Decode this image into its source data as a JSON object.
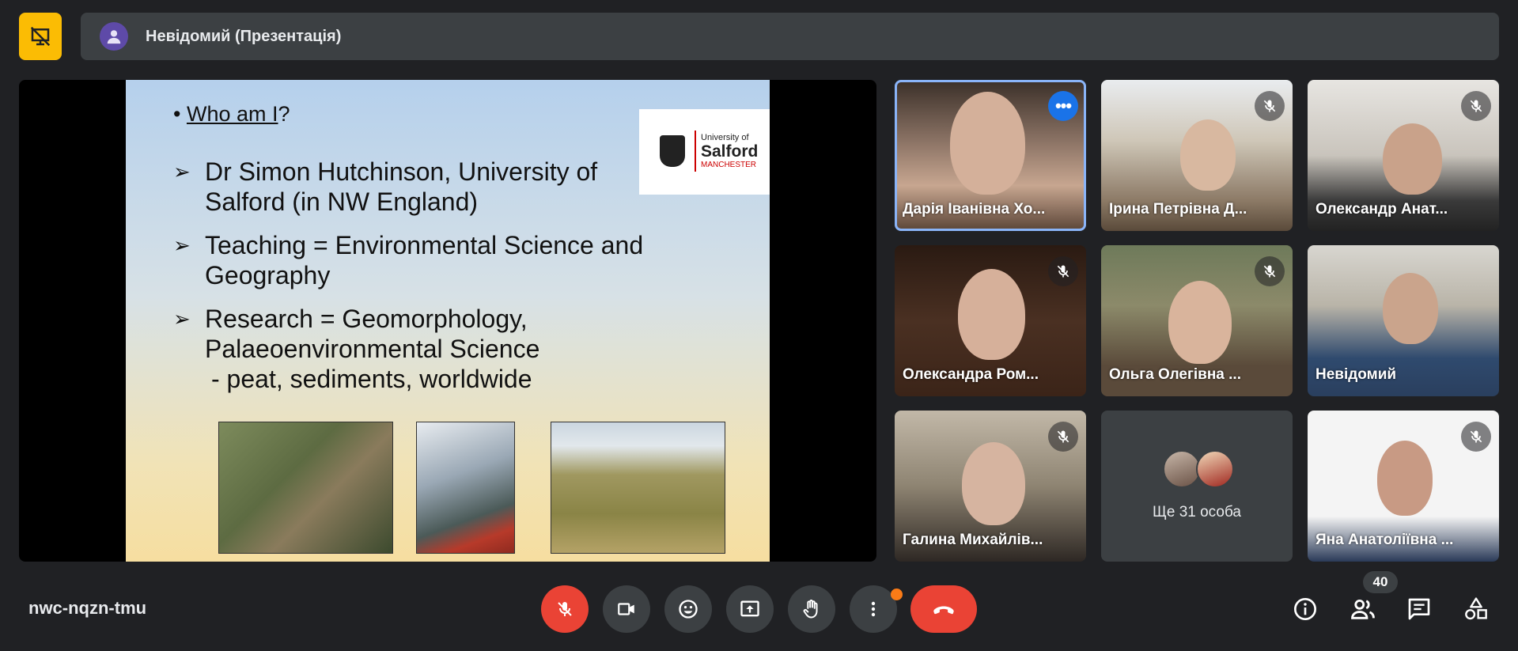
{
  "topbar": {
    "presenter_title": "Невідомий (Презентація)"
  },
  "slide": {
    "question_prefix": "• ",
    "question": "Who am I",
    "question_suffix": "?",
    "points": [
      {
        "arrow": "➢",
        "text": "Dr Simon Hutchinson, University of Salford (in NW England)"
      },
      {
        "arrow": "➢",
        "text": "Teaching = Environmental Science and Geography"
      },
      {
        "arrow": "➢",
        "text": "Research = Geomorphology, Palaeoenvironmental Science"
      }
    ],
    "sub_point": "- peat, sediments, worldwide",
    "logo": {
      "line1": "University of",
      "line2": "Salford",
      "line3": "MANCHESTER"
    }
  },
  "participants": [
    {
      "name": "Дарія Іванівна Хо...",
      "state": "active",
      "icon": "more-options-icon"
    },
    {
      "name": "Ірина Петрівна Д...",
      "state": "muted",
      "icon": "mic-off-icon"
    },
    {
      "name": "Олександр Анат...",
      "state": "muted",
      "icon": "mic-off-icon"
    },
    {
      "name": "Олександра Ром...",
      "state": "muted",
      "icon": "mic-off-icon"
    },
    {
      "name": "Ольга Олегівна ...",
      "state": "muted",
      "icon": "mic-off-icon"
    },
    {
      "name": "Невідомий",
      "state": "presenting"
    },
    {
      "name": "Галина Михайлів...",
      "state": "muted",
      "icon": "mic-off-icon"
    },
    {
      "name": "Яна Анатоліївна ...",
      "state": "muted",
      "icon": "mic-off-icon"
    }
  ],
  "others_tile": {
    "label": "Ще 31 особа"
  },
  "bottom": {
    "meeting_code": "nwc-nqzn-tmu",
    "participants_count": "40",
    "colors": {
      "danger": "#ea4335",
      "accent": "#fbbc04",
      "notify": "#fa7b17",
      "active": "#8ab4f8"
    }
  }
}
